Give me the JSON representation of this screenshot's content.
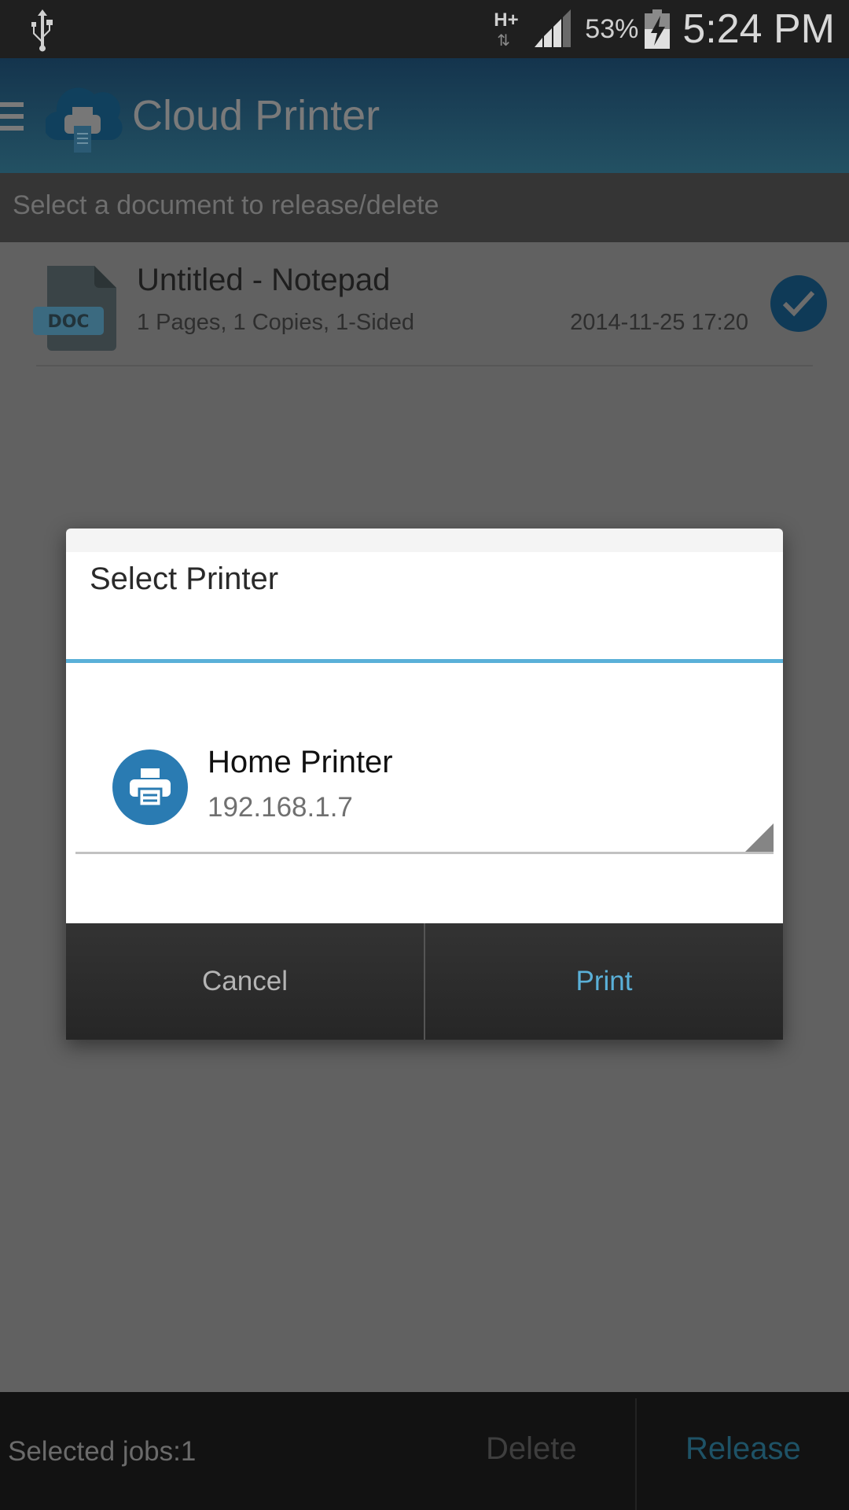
{
  "status_bar": {
    "left_icon": "usb-icon",
    "network_type": "H+",
    "network_arrows": "⇅",
    "signal_icon": "signal-strength-icon",
    "battery_percent": "53%",
    "battery_icon": "battery-charging-icon",
    "time": "5:24 PM"
  },
  "app_bar": {
    "menu_icon": "hamburger-menu-icon",
    "logo_icon": "cloud-printer-logo-icon",
    "title": "Cloud Printer"
  },
  "sub_header": {
    "text": "Select a document to release/delete"
  },
  "jobs": [
    {
      "icon": "doc-file-icon",
      "icon_label": "DOC",
      "title": "Untitled - Notepad",
      "details": "1 Pages, 1 Copies, 1-Sided",
      "date": "2014-11-25 17:20",
      "selected": true
    }
  ],
  "dialog": {
    "title": "Select Printer",
    "printers": [
      {
        "icon": "printer-icon",
        "name": "Home Printer",
        "ip": "192.168.1.7"
      }
    ],
    "cancel_label": "Cancel",
    "print_label": "Print"
  },
  "bottom_bar": {
    "selected_jobs": "Selected jobs:1",
    "delete_label": "Delete",
    "release_label": "Release"
  },
  "colors": {
    "accent_blue": "#5ab0d8",
    "printer_icon_blue": "#2a7bb2",
    "app_bar_top": "#14344d",
    "app_bar_bottom": "#235163",
    "selected_check": "#0f3a57"
  }
}
